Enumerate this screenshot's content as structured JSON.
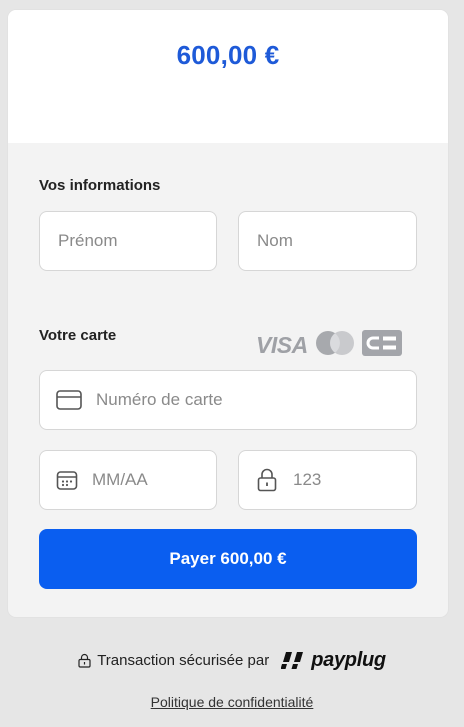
{
  "header": {
    "amount": "600,00 €"
  },
  "info": {
    "title": "Vos informations",
    "first_name_placeholder": "Prénom",
    "last_name_placeholder": "Nom"
  },
  "card": {
    "title": "Votre carte",
    "brands": [
      "VISA",
      "mastercard",
      "CB"
    ],
    "visa_label": "VISA",
    "card_number_placeholder": "Numéro de carte",
    "expiry_placeholder": "MM/AA",
    "cvc_placeholder": "123"
  },
  "pay_button_label": "Payer 600,00 €",
  "footer": {
    "secure_text": "Transaction sécurisée par",
    "provider": "payplug",
    "privacy_link": "Politique de confidentialité"
  },
  "colors": {
    "accent": "#0a5ef0",
    "amount": "#1e5ad8",
    "background": "#e6e6e6",
    "panel": "#f3f3f3"
  }
}
